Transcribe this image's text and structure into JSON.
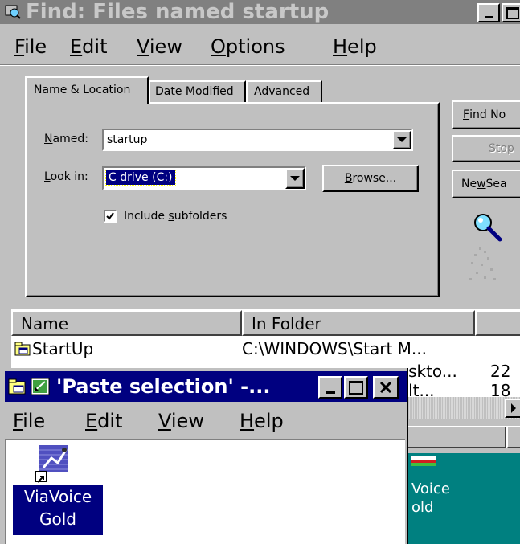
{
  "find_window": {
    "title": "Find: Files named startup",
    "menu": [
      {
        "label": "File",
        "u": "F",
        "rest": "ile"
      },
      {
        "label": "Edit",
        "u": "E",
        "rest": "dit"
      },
      {
        "label": "View",
        "u": "V",
        "rest": "iew"
      },
      {
        "label": "Options",
        "u": "O",
        "rest": "ptions"
      },
      {
        "label": "Help",
        "u": "H",
        "rest": "elp"
      }
    ],
    "tabs": [
      "Name & Location",
      "Date Modified",
      "Advanced"
    ],
    "named_label_u": "N",
    "named_label_rest": "amed:",
    "named_value": "startup",
    "lookin_label_u": "L",
    "lookin_label_rest": "ook in:",
    "lookin_value": "C drive (C:)",
    "browse_u": "B",
    "browse_rest": "rowse...",
    "include_pre": "Include ",
    "include_u": "s",
    "include_rest": "ubfolders",
    "include_checked": true,
    "find_now_pre": "F",
    "find_now_rest": "ind No",
    "stop_label": "Stop",
    "new_search_pre": "Ne",
    "new_search_u": "w",
    "new_search_rest": " Sea",
    "results": {
      "headers": [
        "Name",
        "In Folder"
      ],
      "rows": [
        {
          "name": "StartUp",
          "folder": "C:\\WINDOWS\\Start M..."
        },
        {
          "name": "",
          "folder": "...skto...",
          "extra": "22"
        },
        {
          "name": "",
          "folder": "...lt...",
          "extra": "18"
        }
      ]
    }
  },
  "paste_window": {
    "title": "'Paste selection' -...",
    "menu": [
      {
        "label": "File",
        "u": "F",
        "rest": "ile"
      },
      {
        "label": "Edit",
        "u": "E",
        "rest": "dit"
      },
      {
        "label": "View",
        "u": "V",
        "rest": "iew"
      },
      {
        "label": "Help",
        "u": "H",
        "rest": "elp"
      }
    ],
    "icon_label_line1": "ViaVoice",
    "icon_label_line2": "Gold"
  },
  "background_window": {
    "icon_label_line1": "Voice",
    "icon_label_line2": "old"
  }
}
